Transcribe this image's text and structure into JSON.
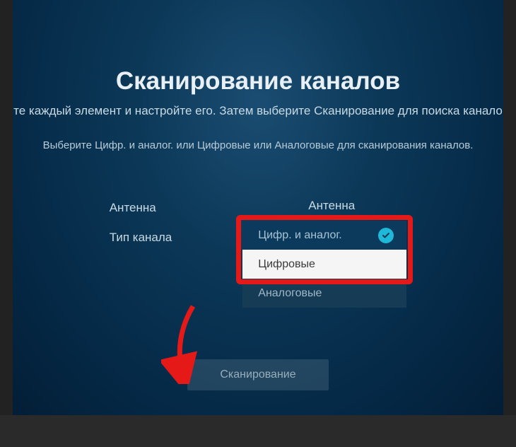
{
  "title": "Сканирование каналов",
  "instruction1": "те каждый элемент и настройте его. Затем выберите Сканирование для поиска канало",
  "instruction2": "Выберите Цифр. и аналог. или Цифровые или Аналоговые для сканирования каналов.",
  "settings": {
    "antenna_label": "Антенна",
    "antenna_value": "Антенна",
    "channel_type_label": "Тип канала"
  },
  "channel_type_options": {
    "selected": "Цифр. и аналог.",
    "highlighted": "Цифровые",
    "plain": "Аналоговые"
  },
  "scan_button": "Сканирование"
}
